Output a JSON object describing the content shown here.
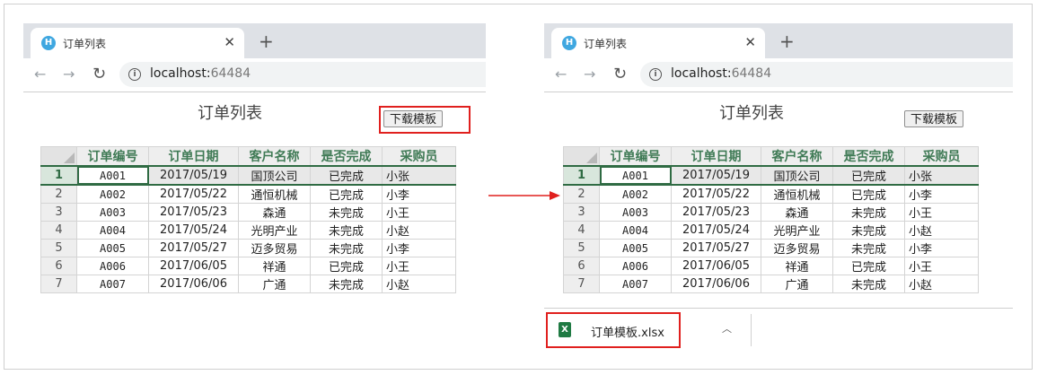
{
  "browser": {
    "tab_title": "订单列表",
    "tab_icon_letter": "H",
    "close_glyph": "✕",
    "newtab_glyph": "+",
    "back_glyph": "←",
    "forward_glyph": "→",
    "reload_glyph": "↻",
    "info_glyph": "i",
    "url_host": "localhost:",
    "url_port": "64484"
  },
  "page": {
    "title": "订单列表",
    "download_button": "下载模板"
  },
  "table": {
    "headers": [
      "订单编号",
      "订单日期",
      "客户名称",
      "是否完成",
      "采购员"
    ],
    "rows": [
      {
        "num": "1",
        "cells": [
          "A001",
          "2017/05/19",
          "国顶公司",
          "已完成",
          "小张"
        ]
      },
      {
        "num": "2",
        "cells": [
          "A002",
          "2017/05/22",
          "通恒机械",
          "已完成",
          "小李"
        ]
      },
      {
        "num": "3",
        "cells": [
          "A003",
          "2017/05/23",
          "森通",
          "未完成",
          "小王"
        ]
      },
      {
        "num": "4",
        "cells": [
          "A004",
          "2017/05/24",
          "光明产业",
          "未完成",
          "小赵"
        ]
      },
      {
        "num": "5",
        "cells": [
          "A005",
          "2017/05/27",
          "迈多贸易",
          "未完成",
          "小李"
        ]
      },
      {
        "num": "6",
        "cells": [
          "A006",
          "2017/06/05",
          "祥通",
          "已完成",
          "小王"
        ]
      },
      {
        "num": "7",
        "cells": [
          "A007",
          "2017/06/06",
          "广通",
          "未完成",
          "小赵"
        ]
      }
    ]
  },
  "download_bar": {
    "file_name": "订单模板.xlsx",
    "file_icon_letter": "X",
    "caret_glyph": "︿"
  },
  "colors": {
    "highlight": "#e0201e",
    "arrow": "#e0201e",
    "header_text": "#3f7a55",
    "selection": "#2f6b43"
  }
}
